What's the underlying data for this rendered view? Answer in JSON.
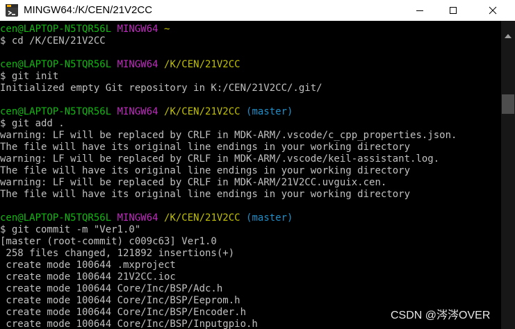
{
  "window": {
    "title": "MINGW64:/K/CEN/21V2CC"
  },
  "terminal": {
    "lines": [
      [
        {
          "t": "cen@LAPTOP-N5TQR56L ",
          "c": "green"
        },
        {
          "t": "MINGW64 ",
          "c": "magenta"
        },
        {
          "t": "~",
          "c": "yellow"
        }
      ],
      [
        {
          "t": "$ cd /K/CEN/21V2CC",
          "c": "white"
        }
      ],
      [],
      [
        {
          "t": "cen@LAPTOP-N5TQR56L ",
          "c": "green"
        },
        {
          "t": "MINGW64 ",
          "c": "magenta"
        },
        {
          "t": "/K/CEN/21V2CC",
          "c": "yellow"
        }
      ],
      [
        {
          "t": "$ git init",
          "c": "white"
        }
      ],
      [
        {
          "t": "Initialized empty Git repository in K:/CEN/21V2CC/.git/",
          "c": "white"
        }
      ],
      [],
      [
        {
          "t": "cen@LAPTOP-N5TQR56L ",
          "c": "green"
        },
        {
          "t": "MINGW64 ",
          "c": "magenta"
        },
        {
          "t": "/K/CEN/21V2CC ",
          "c": "yellow"
        },
        {
          "t": "(master)",
          "c": "cyan"
        }
      ],
      [
        {
          "t": "$ git add .",
          "c": "white"
        }
      ],
      [
        {
          "t": "warning: LF will be replaced by CRLF in MDK-ARM/.vscode/c_cpp_properties.json.",
          "c": "white"
        }
      ],
      [
        {
          "t": "The file will have its original line endings in your working directory",
          "c": "white"
        }
      ],
      [
        {
          "t": "warning: LF will be replaced by CRLF in MDK-ARM/.vscode/keil-assistant.log.",
          "c": "white"
        }
      ],
      [
        {
          "t": "The file will have its original line endings in your working directory",
          "c": "white"
        }
      ],
      [
        {
          "t": "warning: LF will be replaced by CRLF in MDK-ARM/21V2CC.uvguix.cen.",
          "c": "white"
        }
      ],
      [
        {
          "t": "The file will have its original line endings in your working directory",
          "c": "white"
        }
      ],
      [],
      [
        {
          "t": "cen@LAPTOP-N5TQR56L ",
          "c": "green"
        },
        {
          "t": "MINGW64 ",
          "c": "magenta"
        },
        {
          "t": "/K/CEN/21V2CC ",
          "c": "yellow"
        },
        {
          "t": "(master)",
          "c": "cyan"
        }
      ],
      [
        {
          "t": "$ git commit -m \"Ver1.0\"",
          "c": "white"
        }
      ],
      [
        {
          "t": "[master (root-commit) c009c63] Ver1.0",
          "c": "white"
        }
      ],
      [
        {
          "t": " 258 files changed, 121892 insertions(+)",
          "c": "white"
        }
      ],
      [
        {
          "t": " create mode 100644 .mxproject",
          "c": "white"
        }
      ],
      [
        {
          "t": " create mode 100644 21V2CC.ioc",
          "c": "white"
        }
      ],
      [
        {
          "t": " create mode 100644 Core/Inc/BSP/Adc.h",
          "c": "white"
        }
      ],
      [
        {
          "t": " create mode 100644 Core/Inc/BSP/Eeprom.h",
          "c": "white"
        }
      ],
      [
        {
          "t": " create mode 100644 Core/Inc/BSP/Encoder.h",
          "c": "white"
        }
      ],
      [
        {
          "t": " create mode 100644 Core/Inc/BSP/Inputgpio.h",
          "c": "white"
        }
      ]
    ]
  },
  "watermark": {
    "text": "CSDN @涔涔OVER"
  },
  "colors": {
    "green": "#12b712",
    "magenta": "#bd2cbd",
    "yellow": "#c0c000",
    "cyan": "#1e8fc8",
    "white": "#c0c0c0",
    "background": "#000000"
  },
  "icons": {
    "app": "git-bash-icon",
    "minimize": "minimize-icon",
    "maximize": "maximize-icon",
    "close": "close-icon",
    "scroll_up": "scroll-up-arrow-icon"
  }
}
